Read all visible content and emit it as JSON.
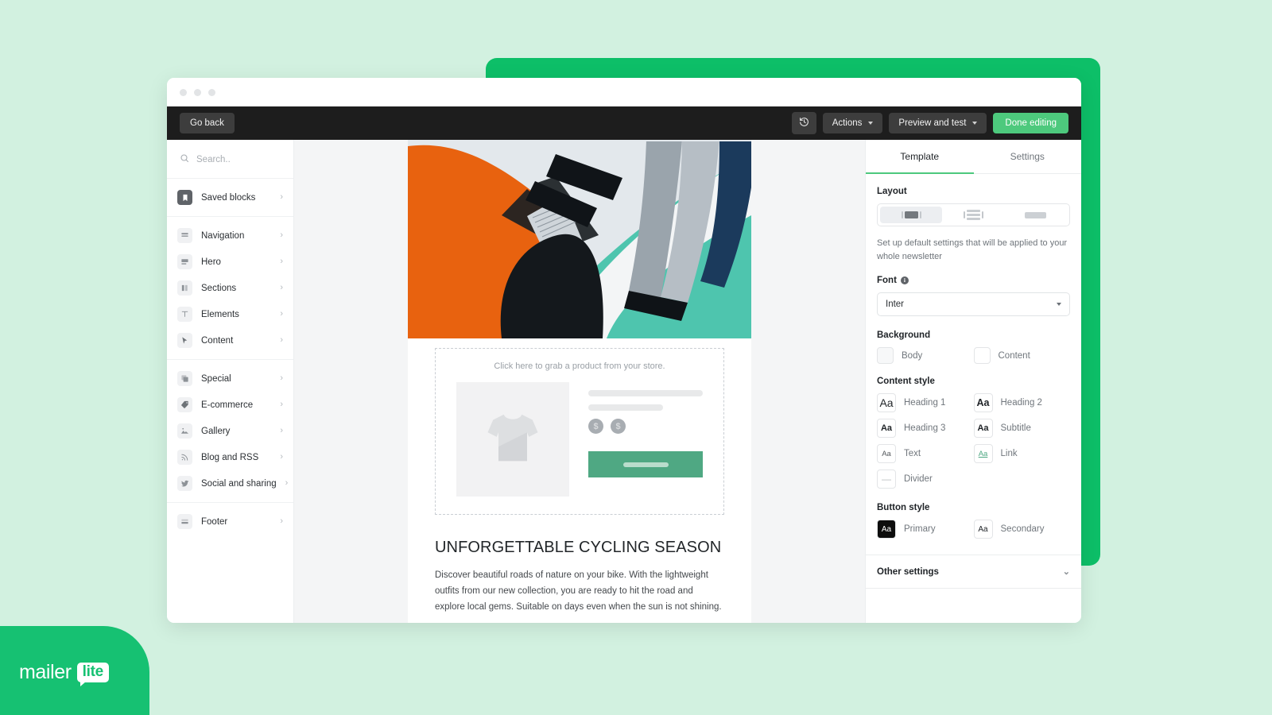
{
  "brand": {
    "logo_text_primary": "mailer",
    "logo_text_badge": "lite",
    "accent_green": "#0dbf68",
    "page_bg": "#d2f1e0",
    "button_green": "#4dc97d"
  },
  "toolbar": {
    "go_back_label": "Go back",
    "history_icon": "history-revert-icon",
    "actions_label": "Actions",
    "preview_label": "Preview and test",
    "done_label": "Done editing"
  },
  "sidebar": {
    "search_placeholder": "Search..",
    "search_icon": "search-icon",
    "groups": [
      {
        "items": [
          {
            "label": "Saved blocks",
            "icon": "bookmark-icon",
            "dark": true
          }
        ]
      },
      {
        "items": [
          {
            "label": "Navigation",
            "icon": "navigation-bar-icon"
          },
          {
            "label": "Hero",
            "icon": "hero-banner-icon"
          },
          {
            "label": "Sections",
            "icon": "columns-icon"
          },
          {
            "label": "Elements",
            "icon": "text-t-icon"
          },
          {
            "label": "Content",
            "icon": "cursor-arrow-icon"
          }
        ]
      },
      {
        "items": [
          {
            "label": "Special",
            "icon": "layers-icon"
          },
          {
            "label": "E-commerce",
            "icon": "price-tag-icon"
          },
          {
            "label": "Gallery",
            "icon": "image-mountain-icon"
          },
          {
            "label": "Blog and RSS",
            "icon": "rss-icon"
          },
          {
            "label": "Social and sharing",
            "icon": "twitter-bird-icon"
          }
        ]
      },
      {
        "items": [
          {
            "label": "Footer",
            "icon": "footer-bar-icon"
          }
        ]
      }
    ]
  },
  "email": {
    "hero_alt": "cycling apparel flat lay on orange and teal background",
    "product_block": {
      "hint": "Click here to grab a product from your store.",
      "image_placeholder_icon": "tshirt-icon",
      "price_placeholder_1": "$",
      "price_placeholder_2": "$"
    },
    "heading": "UNFORGETTABLE CYCLING SEASON",
    "body": "Discover beautiful roads of nature on your bike. With the lightweight outfits from our new collection, you are ready to hit the road and explore local gems. Suitable on days even when the sun is not shining."
  },
  "panel": {
    "tabs": [
      {
        "label": "Template",
        "active": true
      },
      {
        "label": "Settings",
        "active": false
      }
    ],
    "layout": {
      "title": "Layout",
      "options": [
        {
          "name": "boxed",
          "selected": true
        },
        {
          "name": "lines",
          "selected": false
        },
        {
          "name": "full-width",
          "selected": false
        }
      ],
      "description": "Set up default settings that will be applied to your whole newsletter"
    },
    "font": {
      "title": "Font",
      "info_icon": "info-icon",
      "value": "Inter"
    },
    "background": {
      "title": "Background",
      "items": [
        {
          "label": "Body",
          "color": "#f7f8f9"
        },
        {
          "label": "Content",
          "color": "#ffffff"
        }
      ]
    },
    "content_style": {
      "title": "Content style",
      "items": [
        {
          "label": "Heading 1",
          "sample": "Aa"
        },
        {
          "label": "Heading 2",
          "sample": "Aa"
        },
        {
          "label": "Heading 3",
          "sample": "Aa"
        },
        {
          "label": "Subtitle",
          "sample": "Aa"
        },
        {
          "label": "Text",
          "sample": "Aa"
        },
        {
          "label": "Link",
          "sample": "Aa"
        },
        {
          "label": "Divider",
          "sample": "—"
        }
      ]
    },
    "button_style": {
      "title": "Button style",
      "items": [
        {
          "label": "Primary",
          "sample": "Aa"
        },
        {
          "label": "Secondary",
          "sample": "Aa"
        }
      ]
    },
    "other_settings": {
      "label": "Other settings",
      "chevron_icon": "chevron-down-icon"
    }
  }
}
